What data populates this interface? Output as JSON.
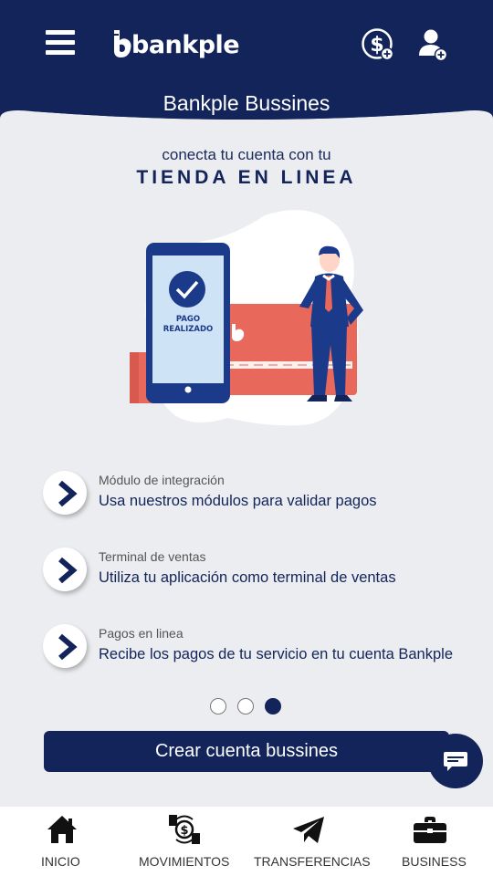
{
  "colors": {
    "primary": "#12245a",
    "background": "#ecedf0",
    "card_red": "#e8695b",
    "white": "#ffffff"
  },
  "header": {
    "brand": "bankple",
    "title": "Bankple Bussines",
    "icons": [
      "menu-icon",
      "dollar-add-icon",
      "user-add-icon"
    ]
  },
  "hero": {
    "subtitle": "conecta tu cuenta con tu",
    "headline": "TIENDA EN LINEA",
    "illustration": {
      "phone_text_line1": "PAGO",
      "phone_text_line2": "REALIZADO"
    }
  },
  "features": [
    {
      "title": "Módulo de integración",
      "description": "Usa nuestros módulos para validar pagos",
      "icon": "chevron-right-icon"
    },
    {
      "title": "Terminal de ventas",
      "description": "Utiliza tu aplicación como terminal de ventas",
      "icon": "chevron-right-icon"
    },
    {
      "title": "Pagos en linea",
      "description": "Recibe los pagos de tu servicio en tu cuenta Bankple",
      "icon": "chevron-right-icon"
    }
  ],
  "pager": {
    "count": 3,
    "active_index": 2
  },
  "cta": {
    "label": "Crear cuenta bussines"
  },
  "chat": {
    "icon": "chat-icon"
  },
  "tabbar": {
    "items": [
      {
        "label": "INICIO",
        "icon": "home-icon"
      },
      {
        "label": "MOVIMIENTOS",
        "icon": "money-exchange-icon"
      },
      {
        "label": "TRANSFERENCIAS",
        "icon": "paper-plane-icon"
      },
      {
        "label": "BUSINESS",
        "icon": "briefcase-icon"
      }
    ]
  }
}
